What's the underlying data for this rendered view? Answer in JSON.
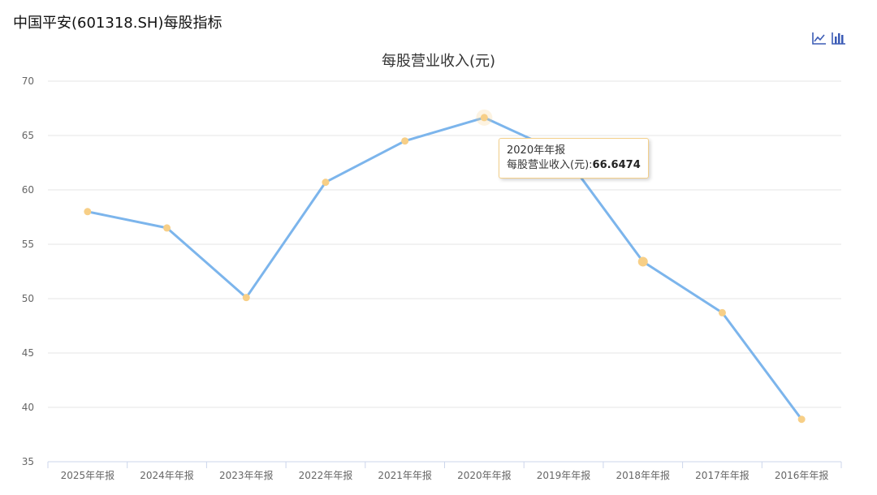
{
  "header": {
    "title": "中国平安(601318.SH)每股指标"
  },
  "toolbar": {
    "line_icon": "line-chart-icon",
    "bar_icon": "bar-chart-icon",
    "icon_color": "#3b5bb5"
  },
  "colors": {
    "line": "#7cb5ec",
    "point": "#f7cf87",
    "grid": "#e6e6e6",
    "axis": "#ccd6eb"
  },
  "tooltip": {
    "category": "2020年年报",
    "series_label": "每股营业收入(元):",
    "value": "66.6474"
  },
  "chart_data": {
    "type": "line",
    "title": "每股营业收入(元)",
    "xlabel": "",
    "ylabel": "",
    "categories": [
      "2025年年报",
      "2024年年报",
      "2023年年报",
      "2022年年报",
      "2021年年报",
      "2020年年报",
      "2019年年报",
      "2018年年报",
      "2017年年报",
      "2016年年报"
    ],
    "series": [
      {
        "values": [
          58.0,
          56.5,
          50.1,
          60.7,
          64.5,
          66.6474,
          63.3,
          53.4,
          48.7,
          38.9
        ]
      }
    ],
    "ylim": [
      35,
      70
    ],
    "yticks": [
      35,
      40,
      45,
      50,
      55,
      60,
      65,
      70
    ],
    "highlighted_category": "2020年年报",
    "grid": true,
    "legend": "none"
  }
}
